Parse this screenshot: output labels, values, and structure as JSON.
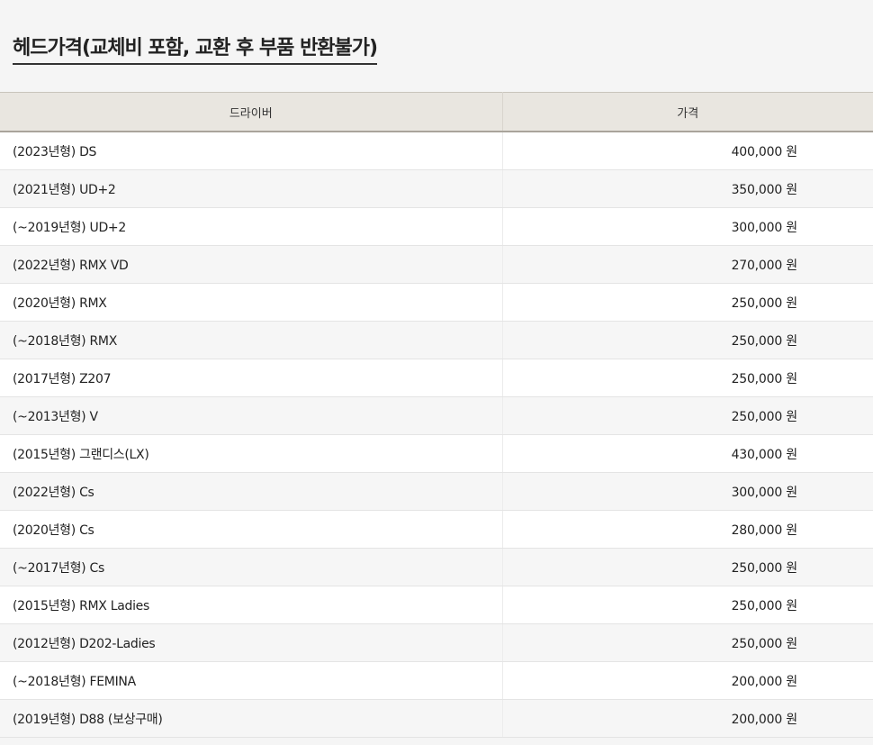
{
  "title": "헤드가격(교체비 포함, 교환 후 부품 반환불가)",
  "table": {
    "headers": [
      "드라이버",
      "가격"
    ],
    "rows": [
      {
        "name": "(2023년형) DS",
        "price": "400,000 원"
      },
      {
        "name": "(2021년형) UD+2",
        "price": "350,000 원"
      },
      {
        "name": "(~2019년형) UD+2",
        "price": "300,000 원"
      },
      {
        "name": "(2022년형) RMX VD",
        "price": "270,000 원"
      },
      {
        "name": "(2020년형) RMX",
        "price": "250,000 원"
      },
      {
        "name": "(~2018년형) RMX",
        "price": "250,000 원"
      },
      {
        "name": "(2017년형) Z207",
        "price": "250,000 원"
      },
      {
        "name": "(~2013년형) V",
        "price": "250,000 원"
      },
      {
        "name": "(2015년형) 그랜디스(LX)",
        "price": "430,000 원"
      },
      {
        "name": "(2022년형) Cs",
        "price": "300,000 원"
      },
      {
        "name": "(2020년형) Cs",
        "price": "280,000 원"
      },
      {
        "name": "(~2017년형) Cs",
        "price": "250,000 원"
      },
      {
        "name": "(2015년형) RMX Ladies",
        "price": "250,000 원"
      },
      {
        "name": "(2012년형) D202-Ladies",
        "price": "250,000 원"
      },
      {
        "name": "(~2018년형) FEMINA",
        "price": "200,000 원"
      },
      {
        "name": "(2019년형) D88 (보상구매)",
        "price": "200,000 원"
      }
    ]
  }
}
